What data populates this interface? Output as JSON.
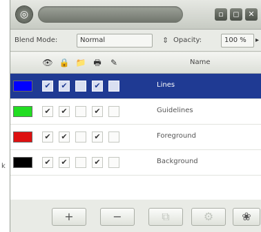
{
  "window": {
    "title": "",
    "menu_glyph": "◎",
    "buttons": [
      {
        "name": "shade-button",
        "glyph": "▫"
      },
      {
        "name": "maximize-button",
        "glyph": "◻"
      },
      {
        "name": "close-button",
        "glyph": "✕"
      }
    ]
  },
  "toolbar": {
    "blend_mode_label": "Blend Mode:",
    "blend_mode_value": "Normal",
    "opacity_label": "Opacity:",
    "opacity_value": "100 %"
  },
  "header": {
    "icons": [
      "visible-icon",
      "lock-icon",
      "folder-icon",
      "print-icon",
      "snap-icon"
    ],
    "icon_glyphs": [
      "👁",
      "🔒",
      "📁",
      "🖶",
      "✎"
    ],
    "name_label": "Name"
  },
  "layers": [
    {
      "name": "Lines",
      "color": "#0000ff",
      "checks": [
        true,
        true,
        false,
        true,
        false
      ],
      "selected": true
    },
    {
      "name": "Guidelines",
      "color": "#22dd22",
      "checks": [
        true,
        true,
        false,
        true,
        false
      ],
      "selected": false
    },
    {
      "name": "Foreground",
      "color": "#dd1111",
      "checks": [
        true,
        true,
        false,
        true,
        false
      ],
      "selected": false
    },
    {
      "name": "Background",
      "color": "#000000",
      "checks": [
        true,
        true,
        false,
        true,
        false
      ],
      "selected": false
    }
  ],
  "bottom_buttons": [
    {
      "name": "add-layer-button",
      "glyph": "+",
      "disabled": false
    },
    {
      "name": "remove-layer-button",
      "glyph": "−",
      "disabled": false
    },
    {
      "name": "duplicate-layer-button",
      "glyph": "⧉",
      "disabled": true
    },
    {
      "name": "layer-settings-button",
      "glyph": "⚙",
      "disabled": true
    },
    {
      "name": "new-group-button",
      "glyph": "❀",
      "disabled": false
    }
  ],
  "side_label": "k"
}
